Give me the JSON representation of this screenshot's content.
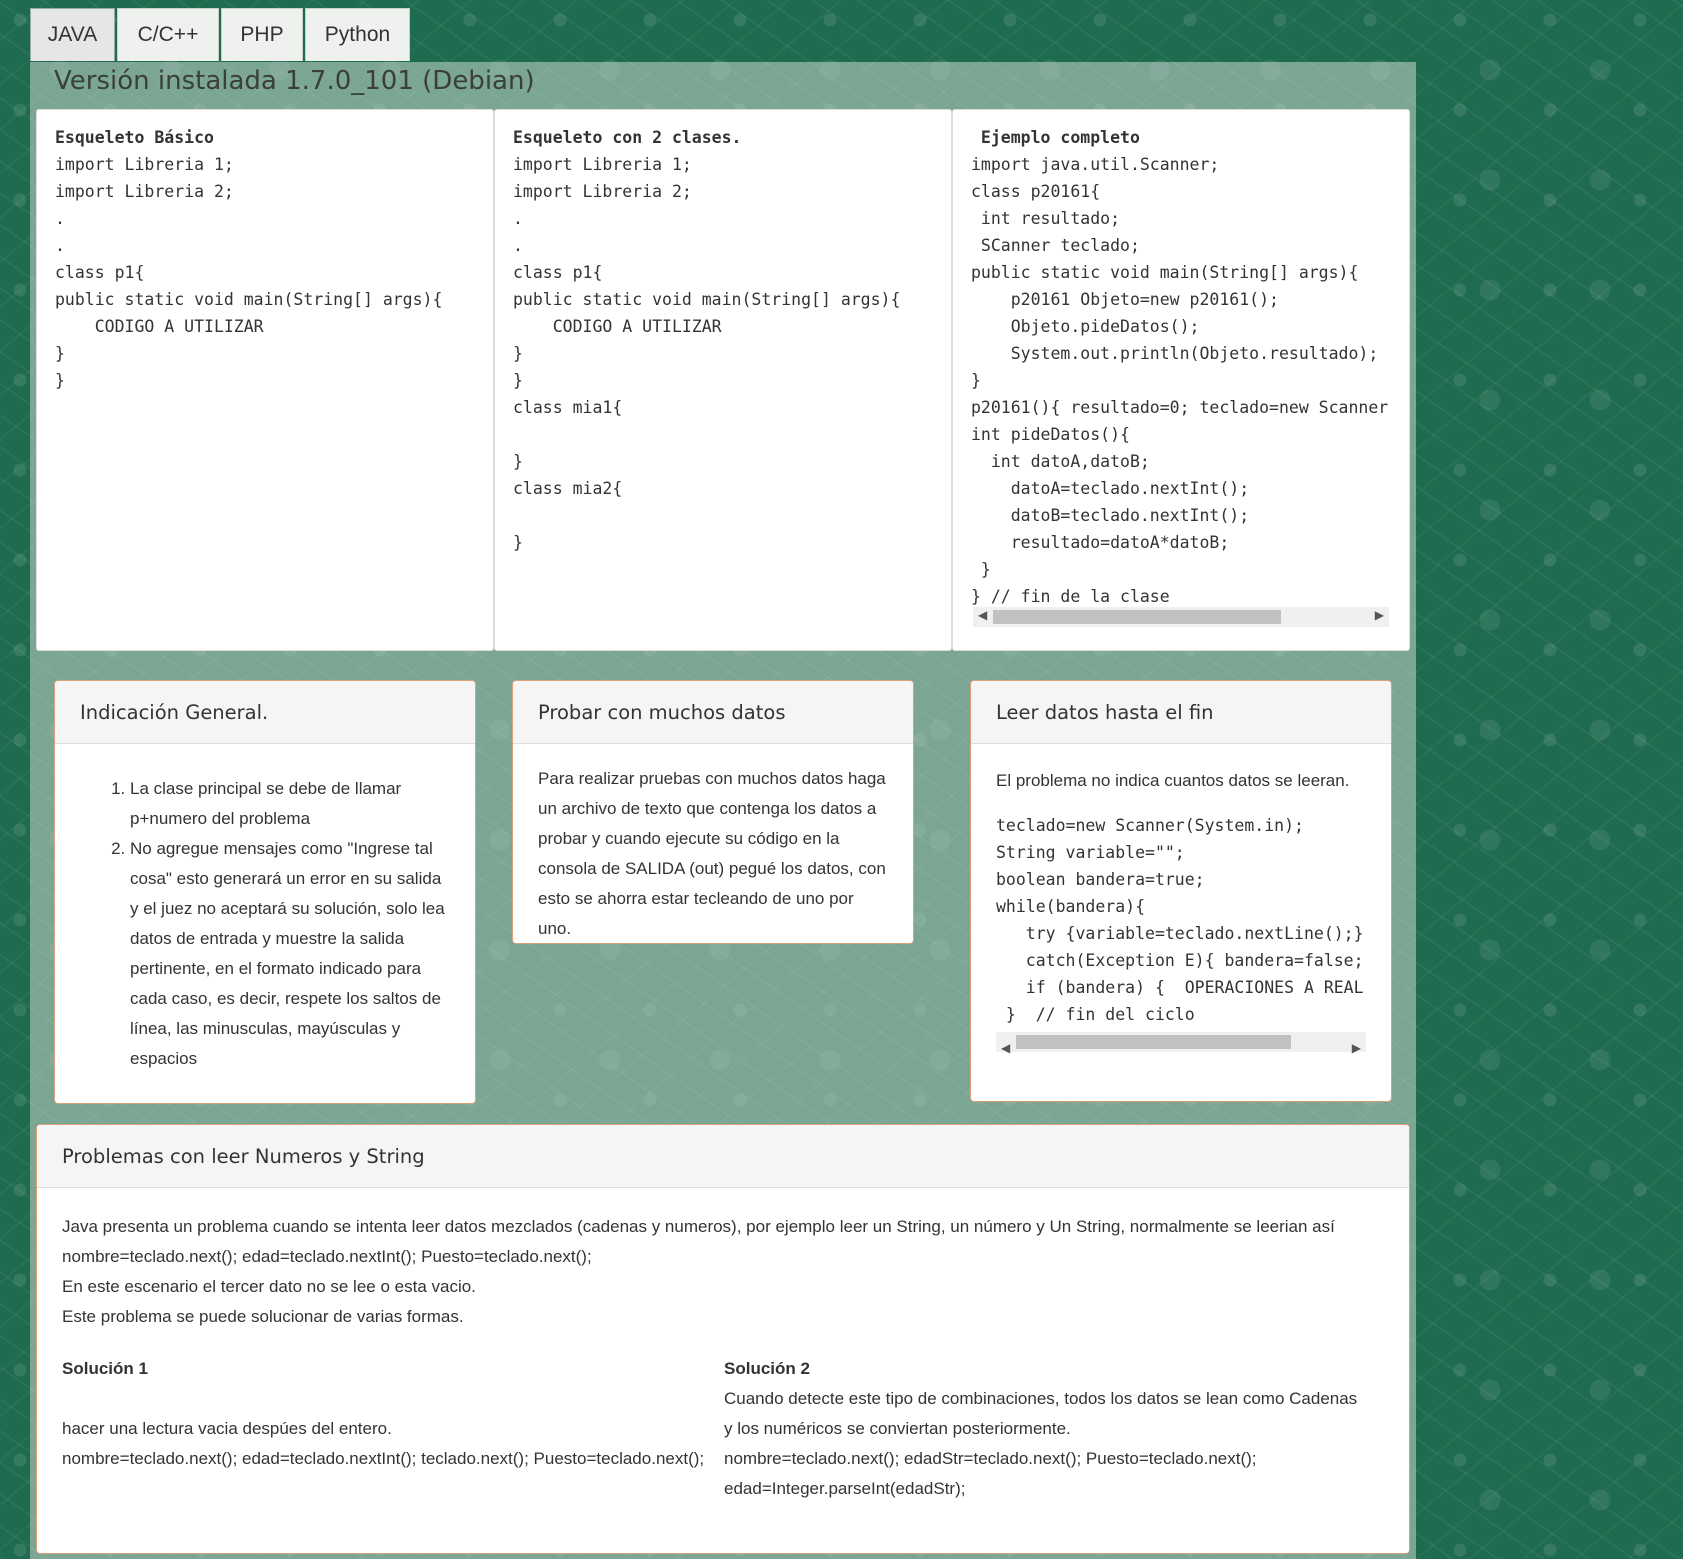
{
  "tabs": [
    "JAVA",
    "C/C++",
    "PHP",
    "Python"
  ],
  "version": "Versión instalada 1.7.0_101 (Debian)",
  "code_columns": [
    {
      "title": "Esqueleto Básico",
      "lines": [
        "import Libreria 1;",
        "import Libreria 2;",
        ".",
        ".",
        "class p1{",
        "public static void main(String[] args){",
        "    CODIGO A UTILIZAR",
        "}",
        "}"
      ]
    },
    {
      "title": "Esqueleto con 2 clases.",
      "lines": [
        "import Libreria 1;",
        "import Libreria 2;",
        ".",
        ".",
        "class p1{",
        "public static void main(String[] args){",
        "    CODIGO A UTILIZAR",
        "}",
        "}",
        "class mia1{",
        "",
        "}",
        "class mia2{",
        "",
        "}"
      ]
    },
    {
      "title": " Ejemplo completo",
      "lines": [
        "import java.util.Scanner;",
        "class p20161{",
        " int resultado;",
        " SCanner teclado;",
        "public static void main(String[] args){",
        "    p20161 Objeto=new p20161();",
        "    Objeto.pideDatos();",
        "    System.out.println(Objeto.resultado);",
        "}",
        "p20161(){ resultado=0; teclado=new Scanner",
        "int pideDatos(){",
        "  int datoA,datoB;",
        "    datoA=teclado.nextInt();",
        "    datoB=teclado.nextInt();",
        "    resultado=datoA*datoB;",
        " }",
        "} // fin de la clase"
      ]
    }
  ],
  "panels": {
    "indicacion": {
      "title": "Indicación General.",
      "items": [
        "La clase principal se debe de llamar p+numero del problema",
        "No agregue mensajes como \"Ingrese tal cosa\" esto generará un error en su salida y el juez no aceptará su solución, solo lea datos de entrada y muestre la salida pertinente, en el formato indicado para cada caso, es decir, respete los saltos de línea, las minusculas, mayúsculas y espacios"
      ]
    },
    "probar": {
      "title": "Probar con muchos datos",
      "text": "Para realizar pruebas con muchos datos haga un archivo de texto que contenga los datos a probar y cuando ejecute su código en la consola de SALIDA (out) pegué los datos, con esto se ahorra estar tecleando de uno por uno."
    },
    "leer": {
      "title": "Leer datos hasta el fin",
      "text": "El problema no indica cuantos datos se leeran.",
      "code": [
        "teclado=new Scanner(System.in);",
        "String variable=\"\";",
        "boolean bandera=true;",
        "while(bandera){",
        "   try {variable=teclado.nextLine();}",
        "   catch(Exception E){ bandera=false;",
        "   if (bandera) {  OPERACIONES A REAL",
        " }  // fin del ciclo"
      ]
    },
    "problemas": {
      "title": "Problemas con leer Numeros y String",
      "lines": [
        "Java presenta un problema cuando se intenta leer datos mezclados (cadenas y numeros), por ejemplo leer un String, un número y Un String, normalmente se leerian así",
        "nombre=teclado.next(); edad=teclado.nextInt(); Puesto=teclado.next();",
        "En este escenario el tercer dato no se lee o esta vacio.",
        "Este problema se puede solucionar de varias formas."
      ],
      "sol1_title": "Solución 1",
      "sol1_lines": [
        "hacer una lectura vacia despúes del entero.",
        "nombre=teclado.next(); edad=teclado.nextInt(); teclado.next(); Puesto=teclado.next();"
      ],
      "sol2_title": "Solución 2",
      "sol2_lines": [
        "Cuando detecte este tipo de combinaciones, todos los datos se lean como Cadenas y los numéricos se conviertan posteriormente.",
        "nombre=teclado.next(); edadStr=teclado.next(); Puesto=teclado.next();",
        "edad=Integer.parseInt(edadStr);"
      ]
    }
  },
  "colors": {
    "background": "#1f6b4f",
    "panel_border": "#d9a07a"
  }
}
